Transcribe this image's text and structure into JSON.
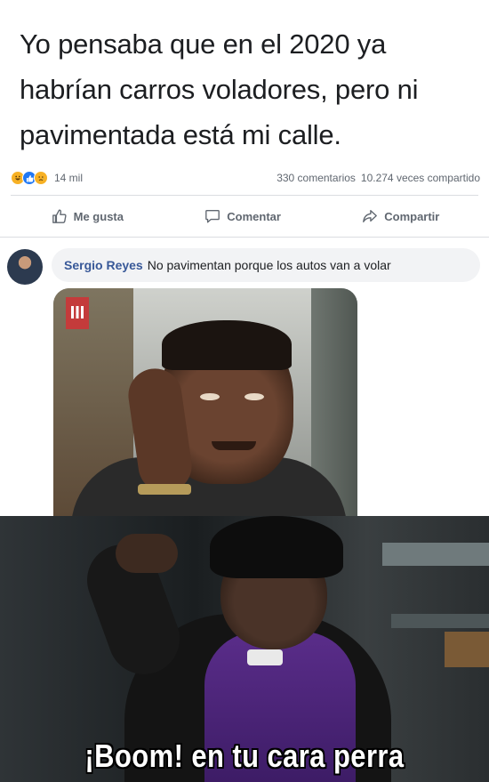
{
  "post": {
    "line1": "Yo pensaba que en el 2020 ya",
    "line2": "habrían carros voladores, pero ni",
    "line3": "pavimentada está mi calle."
  },
  "stats": {
    "reaction_count": "14 mil",
    "comments": "330 comentarios",
    "shares": "10.274 veces compartido",
    "reaction_icons": [
      "haha-icon",
      "like-icon",
      "sad-icon"
    ]
  },
  "actions": {
    "like": "Me gusta",
    "comment": "Comentar",
    "share": "Compartir"
  },
  "comment": {
    "author": "Sergio Reyes",
    "text": "No pavimentan porque los autos van a volar"
  },
  "meme": {
    "caption": "¡Boom! en tu cara perra"
  },
  "colors": {
    "link": "#385898",
    "muted": "#606770",
    "bubble": "#f2f3f5",
    "like_blue": "#2078f4",
    "reaction_yellow": "#f7b125"
  }
}
